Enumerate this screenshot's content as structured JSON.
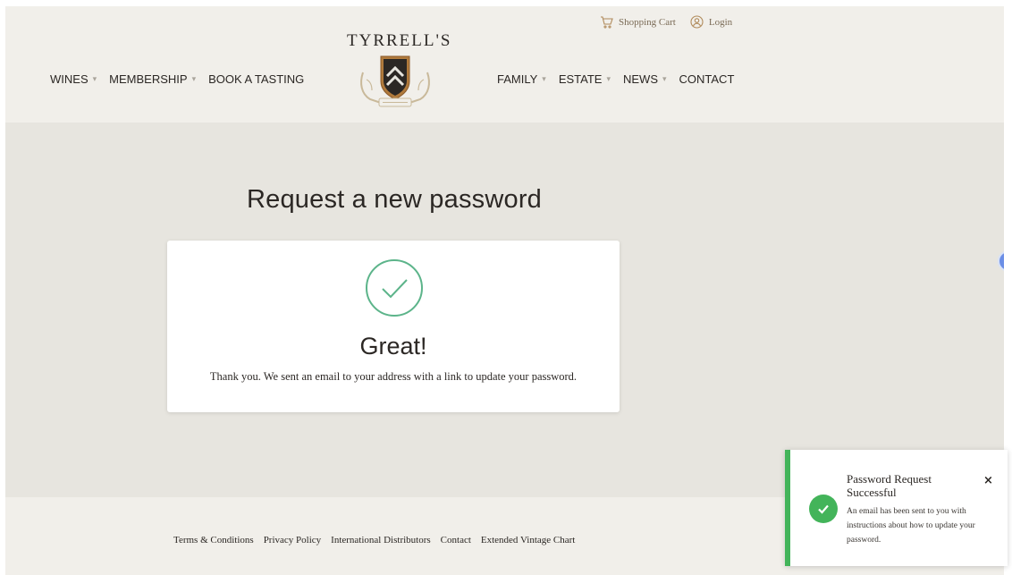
{
  "header": {
    "brand": "TYRRELL'S",
    "utility": {
      "cart_label": "Shopping Cart",
      "login_label": "Login"
    },
    "nav_left": [
      {
        "label": "WINES",
        "has_dropdown": true
      },
      {
        "label": "MEMBERSHIP",
        "has_dropdown": true
      },
      {
        "label": "BOOK A TASTING",
        "has_dropdown": false
      }
    ],
    "nav_right": [
      {
        "label": "FAMILY",
        "has_dropdown": true
      },
      {
        "label": "ESTATE",
        "has_dropdown": true
      },
      {
        "label": "NEWS",
        "has_dropdown": true
      },
      {
        "label": "CONTACT",
        "has_dropdown": false
      }
    ]
  },
  "main": {
    "title": "Request a new password",
    "card": {
      "heading": "Great!",
      "message": "Thank you. We sent an email to your address with a link to update your password."
    }
  },
  "footer": {
    "links": [
      "Terms & Conditions",
      "Privacy Policy",
      "International Distributors",
      "Contact",
      "Extended Vintage Chart"
    ]
  },
  "toast": {
    "title": "Password Request Successful",
    "body": "An email has been sent to you with instructions about how to update your password.",
    "close": "×"
  },
  "colors": {
    "success": "#43b45a",
    "check_circle": "#5cb48a",
    "header_bg": "#f1efea",
    "main_bg": "#e7e5df",
    "accent_gold": "#b08a5a"
  },
  "icons": [
    "cart-icon",
    "user-icon",
    "crest-logo",
    "check-circle-icon",
    "accessibility-icon",
    "close-icon"
  ]
}
